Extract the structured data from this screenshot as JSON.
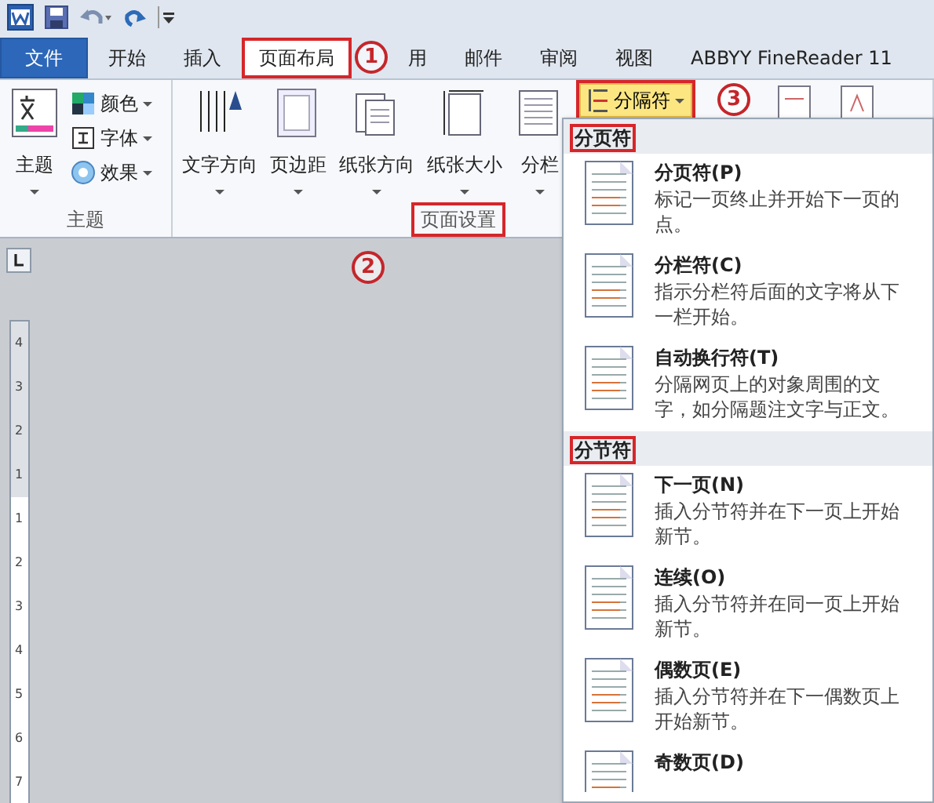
{
  "tabs": [
    {
      "label": "文件",
      "kind": "file",
      "selected": false,
      "highlighted": false
    },
    {
      "label": "开始",
      "kind": "tab",
      "selected": false,
      "highlighted": false
    },
    {
      "label": "插入",
      "kind": "tab",
      "selected": false,
      "highlighted": false
    },
    {
      "label": "页面布局",
      "kind": "tab",
      "selected": true,
      "highlighted": true,
      "callout": "1"
    },
    {
      "label": "用",
      "kind": "tab",
      "selected": false,
      "highlighted": false
    },
    {
      "label": "邮件",
      "kind": "tab",
      "selected": false,
      "highlighted": false
    },
    {
      "label": "审阅",
      "kind": "tab",
      "selected": false,
      "highlighted": false
    },
    {
      "label": "视图",
      "kind": "tab",
      "selected": false,
      "highlighted": false
    },
    {
      "label": "ABBYY FineReader 11",
      "kind": "tab",
      "selected": false,
      "highlighted": false
    }
  ],
  "ribbon": {
    "groups": [
      {
        "label": "主题",
        "highlighted": false,
        "buttons": [
          {
            "label": "主题",
            "kind": "large"
          },
          {
            "label": "颜色",
            "kind": "small"
          },
          {
            "label": "字体",
            "kind": "small"
          },
          {
            "label": "效果",
            "kind": "small"
          }
        ]
      },
      {
        "label": "页面设置",
        "highlighted": true,
        "buttons": [
          {
            "label": "文字方向",
            "kind": "large"
          },
          {
            "label": "页边距",
            "kind": "large"
          },
          {
            "label": "纸张方向",
            "kind": "large"
          },
          {
            "label": "纸张大小",
            "kind": "large"
          },
          {
            "label": "分栏",
            "kind": "large"
          },
          {
            "label": "分隔符",
            "kind": "split",
            "highlighted": true,
            "expanded": true,
            "callout": "3"
          }
        ]
      }
    ]
  },
  "document": {
    "callout": "2",
    "ruler_marks": [
      "4",
      "3",
      "2",
      "1",
      "1",
      "2",
      "3",
      "4",
      "5",
      "6",
      "7"
    ]
  },
  "menu": {
    "sections": [
      {
        "header": "分页符",
        "highlighted": true,
        "items": [
          {
            "title": "分页符(P)",
            "description": "标记一页终止并开始下一页的点。"
          },
          {
            "title": "分栏符(C)",
            "description": "指示分栏符后面的文字将从下一栏开始。"
          },
          {
            "title": "自动换行符(T)",
            "description": "分隔网页上的对象周围的文字，如分隔题注文字与正文。"
          }
        ]
      },
      {
        "header": "分节符",
        "highlighted": true,
        "items": [
          {
            "title": "下一页(N)",
            "description": "插入分节符并在下一页上开始新节。"
          },
          {
            "title": "连续(O)",
            "description": "插入分节符并在同一页上开始新节。"
          },
          {
            "title": "偶数页(E)",
            "description": "插入分节符并在下一偶数页上开始新节。"
          },
          {
            "title": "奇数页(D)"
          }
        ]
      }
    ]
  }
}
